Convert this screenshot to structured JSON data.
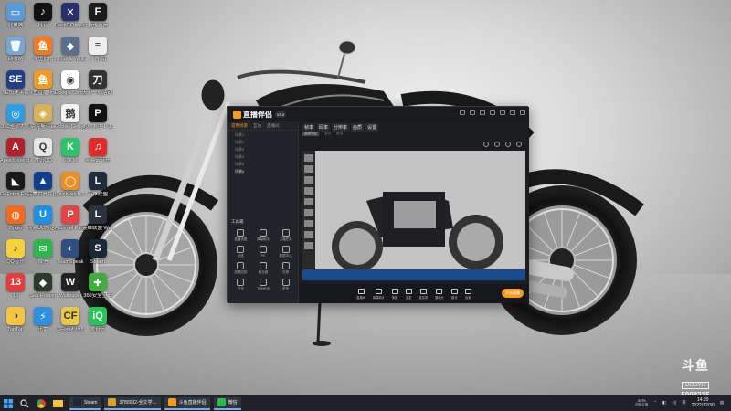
{
  "desktop": {
    "icons": [
      {
        "label": "此电脑",
        "color": "#5a9ad6",
        "glyph": "▭"
      },
      {
        "label": "抖音",
        "color": "#111111",
        "glyph": "♪"
      },
      {
        "label": "DeskGO桌面工具",
        "color": "#2a2f6c",
        "glyph": "✕"
      },
      {
        "label": "极速剪辑",
        "color": "#1c1c1c",
        "glyph": "F"
      },
      {
        "label": "回收站",
        "color": "#7aa7d2",
        "glyph": "🗑"
      },
      {
        "label": "斗鱼直播",
        "color": "#f17a23",
        "glyph": "鱼"
      },
      {
        "label": "Show & Vaults",
        "color": "#5b6f8a",
        "glyph": "◆"
      },
      {
        "label": "广告.txt",
        "color": "#eeeeee",
        "glyph": "≡"
      },
      {
        "label": "SE加速平台",
        "color": "#213d8a",
        "glyph": "SE"
      },
      {
        "label": "斗鱼直播伴侣",
        "color": "#f39b20",
        "glyph": "鱼"
      },
      {
        "label": "Google Chrome",
        "color": "#ffffff",
        "glyph": "◉"
      },
      {
        "label": "天刀一局活动 Main",
        "color": "#333333",
        "glyph": "刀"
      },
      {
        "label": "360驱动大师",
        "color": "#2d9ee2",
        "glyph": "◎"
      },
      {
        "label": "萨克斯平台",
        "color": "#d6b25a",
        "glyph": "◈"
      },
      {
        "label": "Goose Goose Duck",
        "color": "#f2f2f2",
        "glyph": "鹅"
      },
      {
        "label": "绝地求生 PUBG",
        "color": "#111111",
        "glyph": "P"
      },
      {
        "label": "Apex Legends",
        "color": "#b3202a",
        "glyph": "A"
      },
      {
        "label": "腾讯QQ",
        "color": "#e6e6e6",
        "glyph": "Q"
      },
      {
        "label": "KOOK",
        "color": "#2ec36b",
        "glyph": "K"
      },
      {
        "label": "网易云音乐",
        "color": "#e02b2b",
        "glyph": "♫"
      },
      {
        "label": "GeForce Experience",
        "color": "#1a1a1a",
        "glyph": "◣"
      },
      {
        "label": "完美世界竞技平台",
        "color": "#0f3f8c",
        "glyph": "▲"
      },
      {
        "label": "Overwatch 2",
        "color": "#e98f25",
        "glyph": "◯"
      },
      {
        "label": "英雄联盟",
        "color": "#1f2c3c",
        "glyph": "L"
      },
      {
        "label": "Origin",
        "color": "#f26a21",
        "glyph": "◍"
      },
      {
        "label": "网易UU加速器",
        "color": "#1c8fe6",
        "glyph": "U"
      },
      {
        "label": "Pummel Party",
        "color": "#e04545",
        "glyph": "P"
      },
      {
        "label": "英雄联盟 WeGame版",
        "color": "#2b3340",
        "glyph": "L"
      },
      {
        "label": "QQ音乐",
        "color": "#f5d23a",
        "glyph": "♪"
      },
      {
        "label": "微信",
        "color": "#2db84d",
        "glyph": "✉"
      },
      {
        "label": "TeamSpeak",
        "color": "#2e4e7d",
        "glyph": "◐"
      },
      {
        "label": "Steam",
        "color": "#1b2838",
        "glyph": "S"
      },
      {
        "label": "13",
        "color": "#e63b3b",
        "glyph": "13"
      },
      {
        "label": "Sea Hoover",
        "color": "#2c3a2c",
        "glyph": "◆"
      },
      {
        "label": "Wallpaper",
        "color": "#222222",
        "glyph": "W"
      },
      {
        "label": "360安全卫士",
        "color": "#3fae3f",
        "glyph": "✚"
      },
      {
        "label": "TapTap",
        "color": "#f4c542",
        "glyph": "◑"
      },
      {
        "label": "迅雷",
        "color": "#2f8fe0",
        "glyph": "⚡"
      },
      {
        "label": "CF穿越火线",
        "color": "#e8c84a",
        "glyph": "CF"
      },
      {
        "label": "爱奇艺",
        "color": "#28c45a",
        "glyph": "iQ"
      }
    ]
  },
  "app_window": {
    "logo_text": "直播伴侣",
    "version": "V5.0",
    "left_tabs": [
      "常用场景",
      "互动",
      "直播间"
    ],
    "scenes": [
      "场景1",
      "场景2",
      "场景3",
      "场景4",
      "场景5",
      "场景6"
    ],
    "tools_title": "工具箱",
    "tools": [
      "直播设置",
      "弹幕助手",
      "主播任务",
      "贴纸",
      "PK",
      "数据中心",
      "观看回放",
      "粉丝团",
      "礼物",
      "红包",
      "互动玩法",
      "更多"
    ],
    "chips": [
      "帧率",
      "码率",
      "分辨率",
      "画质",
      "设置"
    ],
    "chip_sub": [
      "选择分区",
      "显示",
      "推流"
    ],
    "bottom_buttons": [
      "直播间",
      "弹幕助手",
      "美颜",
      "连麦",
      "麦克风",
      "摄像头",
      "推流",
      "设置"
    ],
    "live_button": "开始直播"
  },
  "taskbar": {
    "search_icon": "search-icon",
    "apps": [
      {
        "label": "Steam",
        "color": "#1b2838"
      },
      {
        "label": "3780002-全文学…",
        "color": "#d8a22a"
      },
      {
        "label": "斗鱼直播伴侣",
        "color": "#f39b20"
      },
      {
        "label": "微信",
        "color": "#2db84d"
      }
    ],
    "battery": "44%",
    "battery_sub": "内存占用",
    "ime": "英",
    "time": "14:20",
    "date": "2022/12/30"
  },
  "watermark": {
    "brand": "斗鱼",
    "sub": "DOUYU",
    "room": "5998215"
  }
}
